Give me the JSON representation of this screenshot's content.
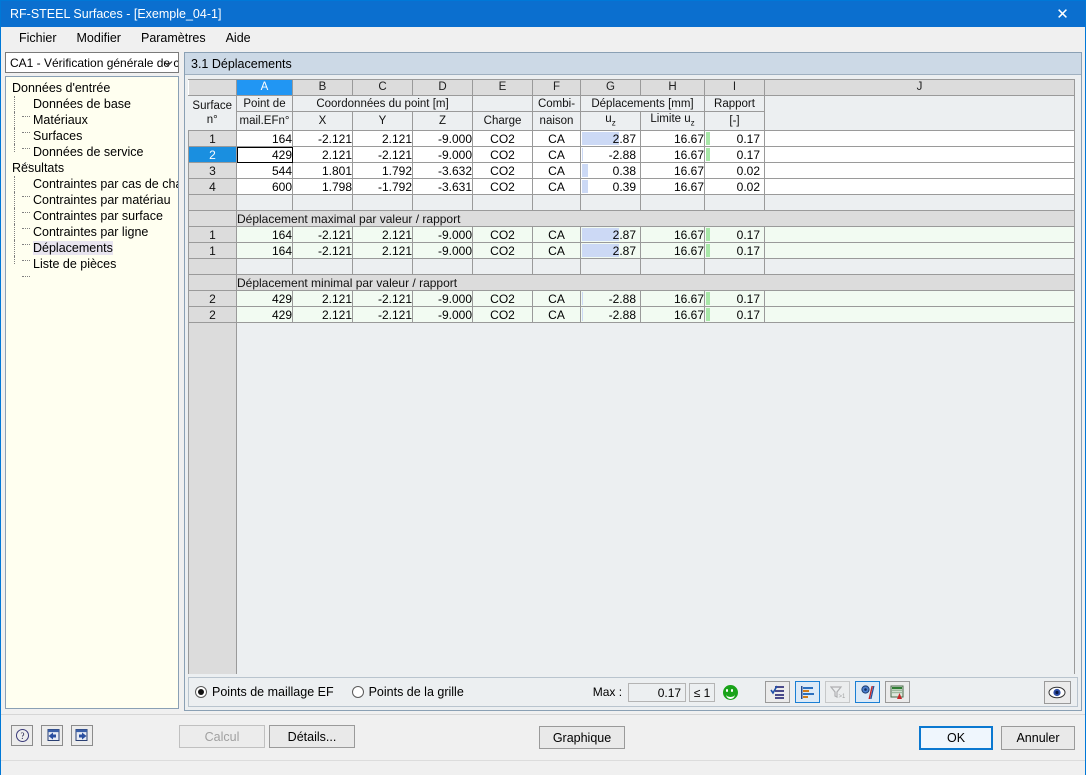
{
  "window": {
    "title": "RF-STEEL Surfaces - [Exemple_04-1]",
    "close_icon": "✕"
  },
  "menu": {
    "items": [
      "Fichier",
      "Modifier",
      "Paramètres",
      "Aide"
    ]
  },
  "sidebar": {
    "combo_value": "CA1 - Vérification générale de c",
    "combo_arrow": "⌄",
    "groups": [
      {
        "label": "Données d'entrée",
        "items": [
          "Données de base",
          "Matériaux",
          "Surfaces",
          "Données de service"
        ]
      },
      {
        "label": "Résultats",
        "items": [
          "Contraintes par cas de charge",
          "Contraintes par matériau",
          "Contraintes par surface",
          "Contraintes par ligne",
          "Déplacements",
          "Liste de pièces"
        ]
      }
    ],
    "selected": "Déplacements"
  },
  "main": {
    "section_title": "3.1 Déplacements",
    "column_letters": [
      "A",
      "B",
      "C",
      "D",
      "E",
      "F",
      "G",
      "H",
      "I",
      "J"
    ],
    "selected_column": "A",
    "headers": {
      "rowhdr_top": "Surface",
      "rowhdr_bottom": "n°",
      "a_top": "Point de",
      "a_bottom": "mail.EFn°",
      "coord_group": "Coordonnées du point [m]",
      "x": "X",
      "y": "Y",
      "z": "Z",
      "charge": "Charge",
      "combi_top": "Combi-",
      "combi_bottom": "naison",
      "depl_group": "Déplacements [mm]",
      "uz": "u",
      "uz_sub": "z",
      "limite": "Limite u",
      "limite_sub": "z",
      "rapport_top": "Rapport",
      "rapport_bottom": "[-]"
    },
    "rows": [
      {
        "surface": "1",
        "point": "164",
        "x": "-2.121",
        "y": "2.121",
        "z": "-9.000",
        "charge": "CO2",
        "combi": "CA",
        "uz": "2.87",
        "limite": "16.67",
        "rapport": "0.17",
        "bar": 0.62,
        "green": true,
        "selected": false,
        "focus": false
      },
      {
        "surface": "2",
        "point": "429",
        "x": "2.121",
        "y": "-2.121",
        "z": "-9.000",
        "charge": "CO2",
        "combi": "CA",
        "uz": "-2.88",
        "limite": "16.67",
        "rapport": "0.17",
        "bar": 0.02,
        "green": true,
        "selected": true,
        "focus": true
      },
      {
        "surface": "3",
        "point": "544",
        "x": "1.801",
        "y": "1.792",
        "z": "-3.632",
        "charge": "CO2",
        "combi": "CA",
        "uz": "0.38",
        "limite": "16.67",
        "rapport": "0.02",
        "bar": 0.1,
        "green": false,
        "selected": false,
        "focus": false
      },
      {
        "surface": "4",
        "point": "600",
        "x": "1.798",
        "y": "-1.792",
        "z": "-3.631",
        "charge": "CO2",
        "combi": "CA",
        "uz": "0.39",
        "limite": "16.67",
        "rapport": "0.02",
        "bar": 0.1,
        "green": false,
        "selected": false,
        "focus": false
      }
    ],
    "max_group_label": "Déplacement maximal par valeur / rapport",
    "max_rows": [
      {
        "surface": "1",
        "point": "164",
        "x": "-2.121",
        "y": "2.121",
        "z": "-9.000",
        "charge": "CO2",
        "combi": "CA",
        "uz": "2.87",
        "limite": "16.67",
        "rapport": "0.17",
        "bar": 0.62,
        "green": true
      },
      {
        "surface": "1",
        "point": "164",
        "x": "-2.121",
        "y": "2.121",
        "z": "-9.000",
        "charge": "CO2",
        "combi": "CA",
        "uz": "2.87",
        "limite": "16.67",
        "rapport": "0.17",
        "bar": 0.62,
        "green": true
      }
    ],
    "min_group_label": "Déplacement minimal par valeur / rapport",
    "min_rows": [
      {
        "surface": "2",
        "point": "429",
        "x": "2.121",
        "y": "-2.121",
        "z": "-9.000",
        "charge": "CO2",
        "combi": "CA",
        "uz": "-2.88",
        "limite": "16.67",
        "rapport": "0.17",
        "bar": 0.02,
        "green": true
      },
      {
        "surface": "2",
        "point": "429",
        "x": "2.121",
        "y": "-2.121",
        "z": "-9.000",
        "charge": "CO2",
        "combi": "CA",
        "uz": "-2.88",
        "limite": "16.67",
        "rapport": "0.17",
        "bar": 0.02,
        "green": true
      }
    ]
  },
  "bottombar": {
    "radio_mesh": "Points de maillage EF",
    "radio_grid": "Points de la grille",
    "selected_radio": "mesh",
    "max_label": "Max :",
    "max_value": "0.17",
    "limit_label": "≤ 1",
    "status_icon": "smiley-green",
    "tools": [
      {
        "name": "filter-check-icon",
        "active": false,
        "dim": false
      },
      {
        "name": "bar-chart-icon",
        "active": true,
        "dim": false
      },
      {
        "name": "filter-gt1-icon",
        "active": false,
        "dim": true
      },
      {
        "name": "color-scale-icon",
        "active": true,
        "dim": false
      },
      {
        "name": "export-excel-icon",
        "active": false,
        "dim": false
      }
    ],
    "view_icon": "eye-icon"
  },
  "footer": {
    "help_icon": "question-icon",
    "prev_icon": "previous-arrow-icon",
    "next_icon": "next-arrow-icon",
    "calcul_label": "Calcul",
    "details_label": "Détails...",
    "graphique_label": "Graphique",
    "ok_label": "OK",
    "cancel_label": "Annuler"
  },
  "colors": {
    "title_bar": "#0b6fcf",
    "selection": "#1a8fe0",
    "bar_fill": "#ccd9f5",
    "ratio_green": "#a8e8a8",
    "green_row": "#f2fbf2"
  }
}
